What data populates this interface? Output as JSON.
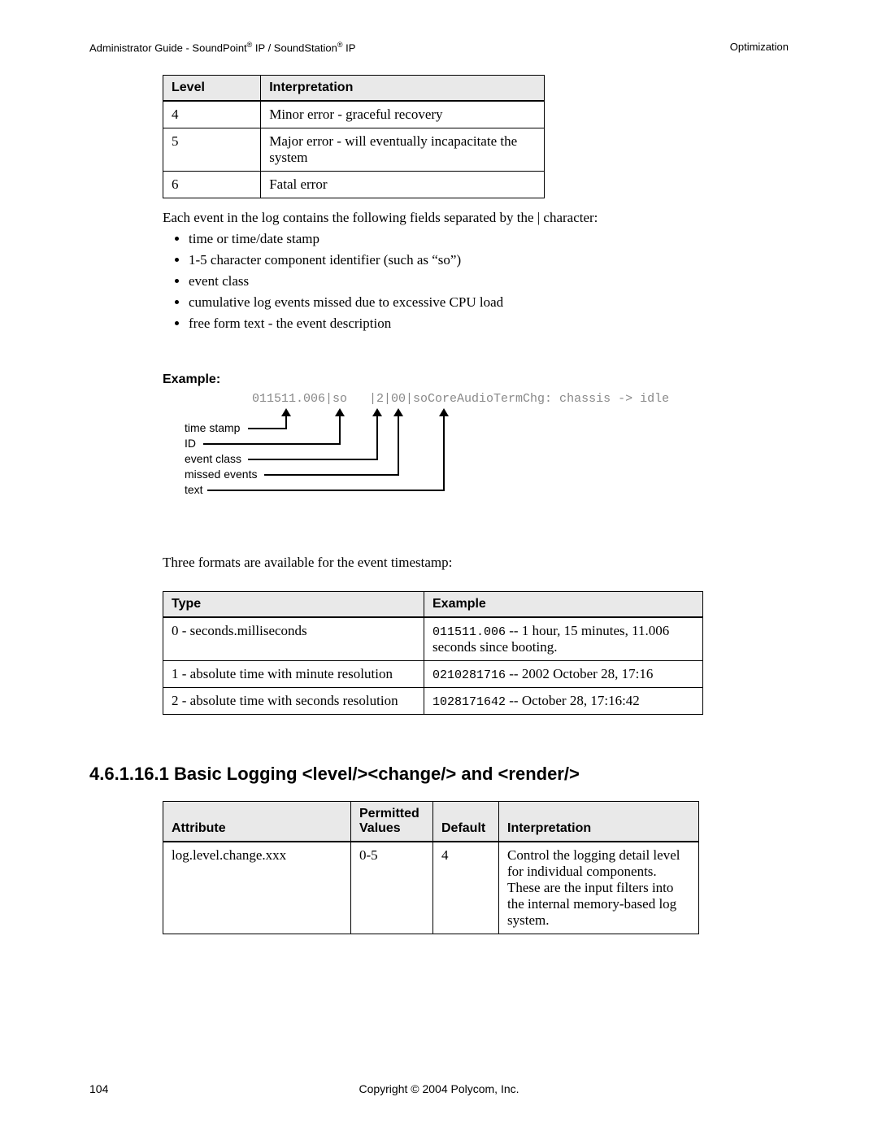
{
  "header": {
    "left_prefix": "Administrator Guide - SoundPoint",
    "left_reg1": "®",
    "left_mid": " IP / SoundStation",
    "left_reg2": "®",
    "left_suffix": " IP",
    "right": "Optimization"
  },
  "table_levels": {
    "headers": [
      "Level",
      "Interpretation"
    ],
    "rows": [
      [
        "4",
        "Minor error - graceful recovery"
      ],
      [
        "5",
        "Major error - will eventually incapacitate the system"
      ],
      [
        "6",
        "Fatal error"
      ]
    ]
  },
  "intro_para": "Each event in the log contains the following fields separated by the | character:",
  "bullets": [
    "time or time/date stamp",
    "1-5 character component identifier (such as “so”)",
    "event class",
    "cumulative log events missed due to excessive CPU load",
    "free form text - the event description"
  ],
  "example_title": "Example:",
  "example_code": "011511.006|so   |2|00|soCoreAudioTermChg: chassis -> idle",
  "example_labels": {
    "time_stamp": "time stamp",
    "id": "ID",
    "event_class": "event class",
    "missed_events": "missed events",
    "text": "text"
  },
  "para2": "Three formats are available for the event timestamp:",
  "table2": {
    "headers": [
      "Type",
      "Example"
    ],
    "rows": [
      {
        "type": "0 - seconds.milliseconds",
        "code": "011511.006",
        "desc": " -- 1 hour, 15 minutes, 11.006 seconds since booting."
      },
      {
        "type": "1 - absolute time with minute resolution",
        "code": "0210281716",
        "desc": " -- 2002 October 28, 17:16"
      },
      {
        "type": "2 - absolute time with seconds resolution",
        "code": "1028171642",
        "desc": " -- October 28, 17:16:42"
      }
    ]
  },
  "section_heading": "4.6.1.16.1  Basic Logging <level/><change/> and <render/>",
  "table3": {
    "headers": [
      "Attribute",
      "Permitted Values",
      "Default",
      "Interpretation"
    ],
    "rows": [
      {
        "attr": "log.level.change.xxx",
        "perm": "0-5",
        "def": "4",
        "interp": "Control the logging detail level for individual components. These are the input filters into the internal memory-based log system."
      }
    ]
  },
  "footer": {
    "page_num": "104",
    "center": "Copyright © 2004 Polycom, Inc."
  }
}
